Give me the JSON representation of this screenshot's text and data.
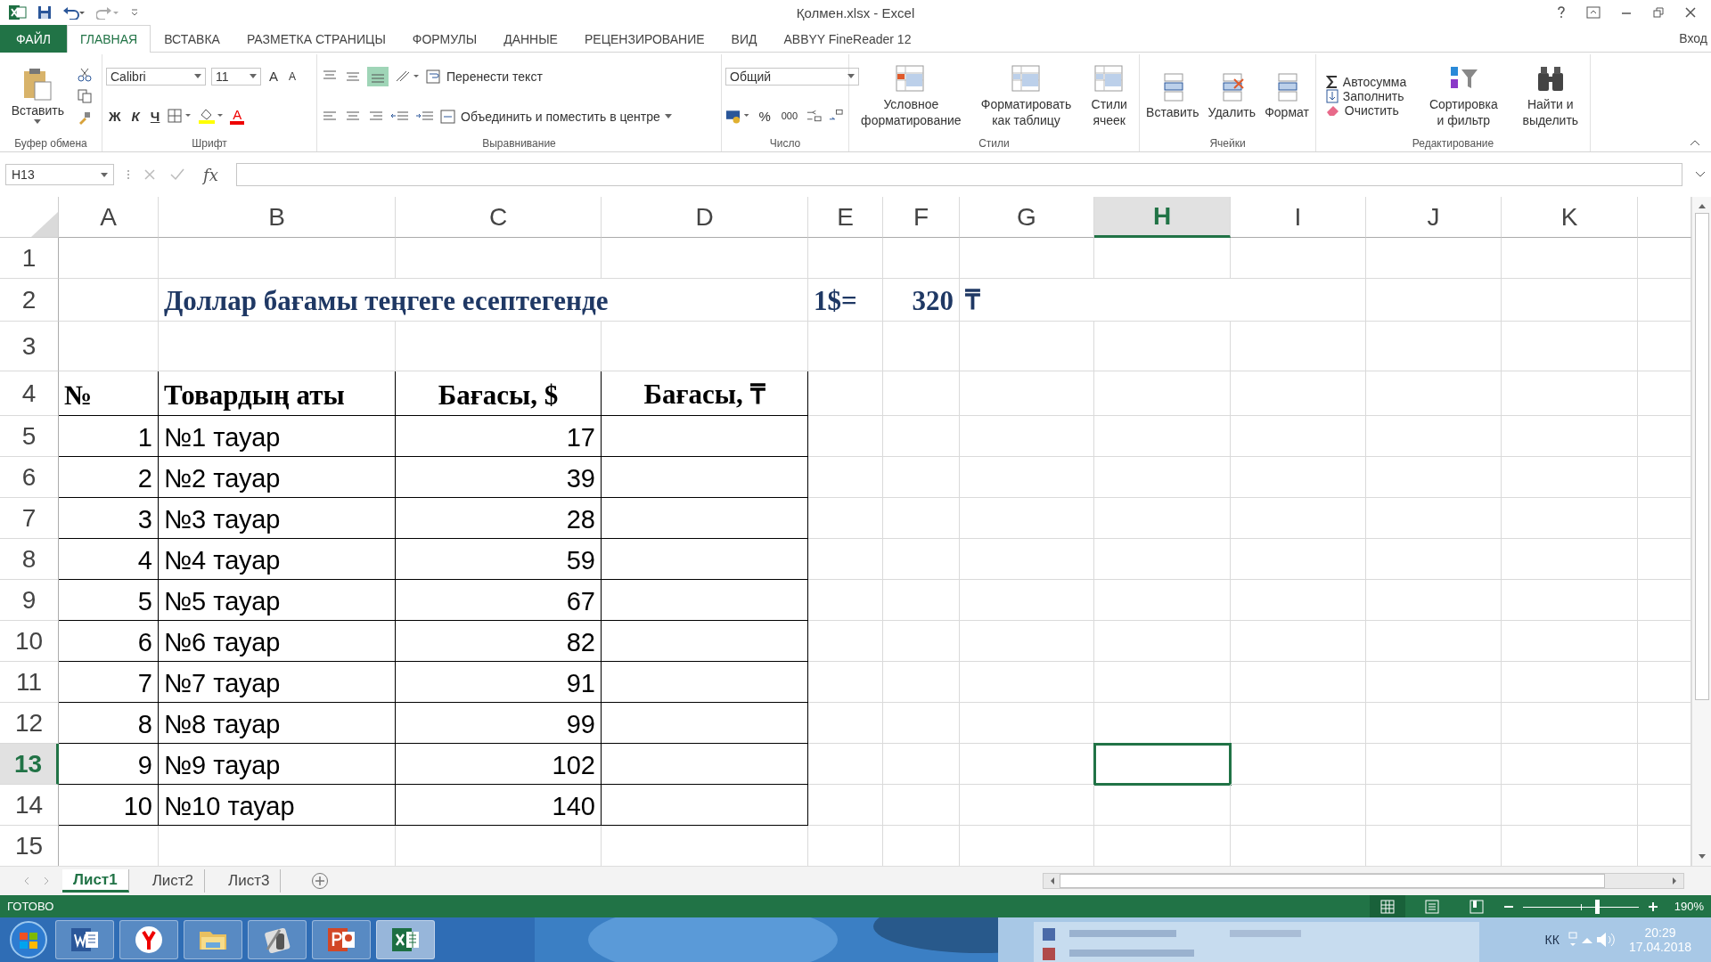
{
  "window": {
    "title": "Қолмен.xlsx - Excel"
  },
  "ribbon_tabs": [
    {
      "label": "ФАЙЛ",
      "kind": "file",
      "selected": false
    },
    {
      "label": "ГЛАВНАЯ",
      "kind": "tab",
      "selected": true
    },
    {
      "label": "ВСТАВКА",
      "kind": "tab",
      "selected": false
    },
    {
      "label": "РАЗМЕТКА СТРАНИЦЫ",
      "kind": "tab",
      "selected": false
    },
    {
      "label": "ФОРМУЛЫ",
      "kind": "tab",
      "selected": false
    },
    {
      "label": "ДАННЫЕ",
      "kind": "tab",
      "selected": false
    },
    {
      "label": "РЕЦЕНЗИРОВАНИЕ",
      "kind": "tab",
      "selected": false
    },
    {
      "label": "ВИД",
      "kind": "tab",
      "selected": false
    },
    {
      "label": "ABBYY FineReader 12",
      "kind": "tab",
      "selected": false
    }
  ],
  "account": "Вход",
  "clipboard": {
    "label": "Буфер обмена",
    "paste": "Вставить"
  },
  "font": {
    "label": "Шрифт",
    "name": "Calibri",
    "size": "11",
    "grow": "A",
    "shrink": "A",
    "bold": "Ж",
    "italic": "К",
    "underline": "Ч",
    "color_letter": "A"
  },
  "alignment": {
    "label": "Выравнивание",
    "wrap": "Перенести текст",
    "merge": "Объединить и поместить в центре"
  },
  "number": {
    "label": "Число",
    "format": "Общий",
    "percent": "%",
    "thousands": "000"
  },
  "styles": {
    "label": "Стили",
    "buttons": [
      {
        "lines": [
          "Условное",
          "форматирование"
        ]
      },
      {
        "lines": [
          "Форматировать",
          "как таблицу"
        ]
      },
      {
        "lines": [
          "Стили",
          "ячеек"
        ]
      }
    ]
  },
  "cells_group": {
    "label": "Ячейки",
    "buttons": [
      "Вставить",
      "Удалить",
      "Формат"
    ]
  },
  "editing": {
    "label": "Редактирование",
    "autosum": "Автосумма",
    "fill": "Заполнить",
    "clear": "Очистить",
    "sort": [
      "Сортировка",
      "и фильтр"
    ],
    "find": [
      "Найти и",
      "выделить"
    ]
  },
  "formula_bar": {
    "name_box": "H13",
    "fx": "fx"
  },
  "sheet": {
    "columns": [
      {
        "label": "A",
        "selected": false
      },
      {
        "label": "B",
        "selected": false
      },
      {
        "label": "C",
        "selected": false
      },
      {
        "label": "D",
        "selected": false
      },
      {
        "label": "E",
        "selected": false
      },
      {
        "label": "F",
        "selected": false
      },
      {
        "label": "G",
        "selected": false
      },
      {
        "label": "H",
        "selected": true
      },
      {
        "label": "I",
        "selected": false
      },
      {
        "label": "J",
        "selected": false
      },
      {
        "label": "K",
        "selected": false
      }
    ],
    "rows": [
      {
        "number": "1",
        "kind": "blank",
        "selected": false,
        "cells": {}
      },
      {
        "number": "2",
        "kind": "title",
        "selected": false,
        "cells": {
          "B": "Доллар бағамы теңгеге есептегенде",
          "E": "1$=",
          "F": "320",
          "G": "₸"
        }
      },
      {
        "number": "3",
        "kind": "blank",
        "selected": false,
        "cells": {}
      },
      {
        "number": "4",
        "kind": "header",
        "selected": false,
        "cells": {
          "A": "№",
          "B": "Товардың аты",
          "C": "Бағасы, $",
          "D": "Бағасы, ₸"
        }
      },
      {
        "number": "5",
        "kind": "item",
        "selected": false,
        "cells": {
          "A": "1",
          "B": "№1 тауар",
          "C": "17"
        }
      },
      {
        "number": "6",
        "kind": "item",
        "selected": false,
        "cells": {
          "A": "2",
          "B": "№2 тауар",
          "C": "39"
        }
      },
      {
        "number": "7",
        "kind": "item",
        "selected": false,
        "cells": {
          "A": "3",
          "B": "№3 тауар",
          "C": "28"
        }
      },
      {
        "number": "8",
        "kind": "item",
        "selected": false,
        "cells": {
          "A": "4",
          "B": "№4 тауар",
          "C": "59"
        }
      },
      {
        "number": "9",
        "kind": "item",
        "selected": false,
        "cells": {
          "A": "5",
          "B": "№5 тауар",
          "C": "67"
        }
      },
      {
        "number": "10",
        "kind": "item",
        "selected": false,
        "cells": {
          "A": "6",
          "B": "№6 тауар",
          "C": "82"
        }
      },
      {
        "number": "11",
        "kind": "item",
        "selected": false,
        "cells": {
          "A": "7",
          "B": "№7 тауар",
          "C": "91"
        }
      },
      {
        "number": "12",
        "kind": "item",
        "selected": false,
        "cells": {
          "A": "8",
          "B": "№8 тауар",
          "C": "99"
        }
      },
      {
        "number": "13",
        "kind": "item",
        "selected": true,
        "cells": {
          "A": "9",
          "B": "№9 тауар",
          "C": "102"
        }
      },
      {
        "number": "14",
        "kind": "item",
        "selected": false,
        "cells": {
          "A": "10",
          "B": "№10 тауар",
          "C": "140"
        }
      },
      {
        "number": "15",
        "kind": "blank",
        "selected": false,
        "cells": {}
      }
    ]
  },
  "sheet_tabs": [
    {
      "label": "Лист1",
      "selected": true
    },
    {
      "label": "Лист2",
      "selected": false
    },
    {
      "label": "Лист3",
      "selected": false
    }
  ],
  "status_bar": {
    "status": "ГОТОВО",
    "zoom_slider": {
      "level": 0.64
    },
    "zoom": "190%"
  },
  "taskbar": {
    "language": "КК",
    "time": "20:29",
    "date": "17.04.2018"
  }
}
